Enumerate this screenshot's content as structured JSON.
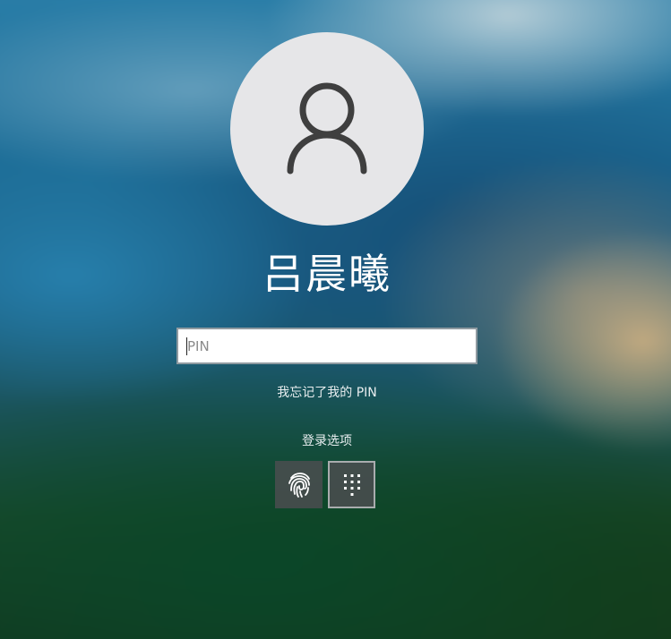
{
  "user": {
    "name": "吕晨曦"
  },
  "pin_input": {
    "placeholder": "PIN",
    "value": ""
  },
  "forgot_pin_link": "我忘记了我的 PIN",
  "signin_options": {
    "label": "登录选项",
    "options": [
      {
        "icon": "fingerprint-icon",
        "selected": false
      },
      {
        "icon": "pin-keypad-icon",
        "selected": true
      }
    ]
  },
  "colors": {
    "avatar_bg": "#e6e6e8",
    "avatar_glyph": "#3f3f3f",
    "text": "#ffffff"
  }
}
